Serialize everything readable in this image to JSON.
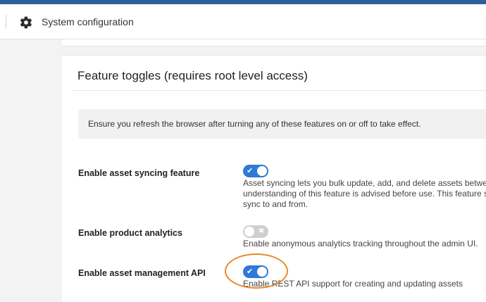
{
  "header": {
    "icon": "gear-icon",
    "title": "System configuration"
  },
  "card": {
    "title": "Feature toggles (requires root level access)",
    "notice": "Ensure you refresh the browser after turning any of these features on or off to take effect."
  },
  "settings": [
    {
      "label": "Enable asset syncing feature",
      "enabled": true,
      "description_lines": [
        "Asset syncing lets you bulk update, add, and delete assets between",
        "understanding of this feature is advised before use. This feature sho",
        "sync to and from."
      ]
    },
    {
      "label": "Enable product analytics",
      "enabled": false,
      "description_lines": [
        "Enable anonymous analytics tracking throughout the admin UI."
      ]
    },
    {
      "label": "Enable asset management API",
      "enabled": true,
      "description_lines": [
        "Enable REST API support for creating and updating assets"
      ]
    }
  ],
  "colors": {
    "top_strip": "#2e5e9a",
    "toggle_on": "#2f79d8",
    "toggle_off": "#cfcfcf",
    "highlight": "#e98a2a"
  },
  "icons": {
    "toggle_on_mark": "✔",
    "toggle_off_mark": "✖"
  }
}
